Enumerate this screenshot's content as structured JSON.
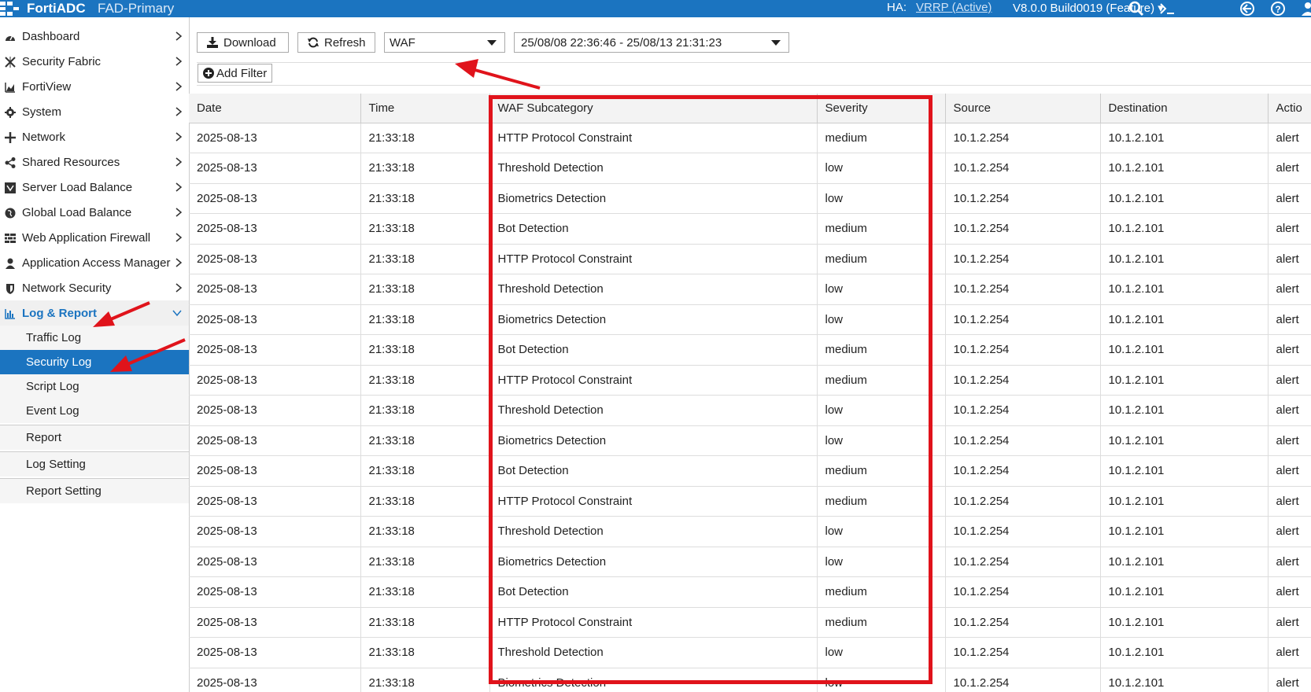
{
  "header": {
    "brand": "FortiADC",
    "hostname": "FAD-Primary",
    "ha_label": "HA:",
    "ha_value": "VRRP (Active)",
    "version": "V8.0.0 Build0019 (Feature)",
    "icons": [
      "search-icon",
      "cli-console-icon",
      "back-icon",
      "help-icon",
      "user-icon"
    ]
  },
  "sidebar": {
    "items": [
      {
        "label": "Dashboard",
        "icon": "dashboard-icon"
      },
      {
        "label": "Security Fabric",
        "icon": "fabric-icon"
      },
      {
        "label": "FortiView",
        "icon": "fortiview-icon"
      },
      {
        "label": "System",
        "icon": "gear-icon"
      },
      {
        "label": "Network",
        "icon": "network-icon"
      },
      {
        "label": "Shared Resources",
        "icon": "share-icon"
      },
      {
        "label": "Server Load Balance",
        "icon": "server-lb-icon"
      },
      {
        "label": "Global Load Balance",
        "icon": "globe-icon"
      },
      {
        "label": "Web Application Firewall",
        "icon": "waf-icon"
      },
      {
        "label": "Application Access Manager",
        "icon": "user-icon"
      },
      {
        "label": "Network Security",
        "icon": "shield-icon"
      },
      {
        "label": "Log & Report",
        "icon": "chart-icon"
      }
    ],
    "subitems": [
      {
        "label": "Traffic Log"
      },
      {
        "label": "Security Log"
      },
      {
        "label": "Script Log"
      },
      {
        "label": "Event Log"
      },
      {
        "label": "Report"
      },
      {
        "label": "Log Setting"
      },
      {
        "label": "Report Setting"
      }
    ],
    "active_item": "Log & Report",
    "selected_subitem": "Security Log"
  },
  "toolbar": {
    "download_label": "Download",
    "refresh_label": "Refresh",
    "log_type": "WAF",
    "time_range": "25/08/08 22:36:46 - 25/08/13 21:31:23",
    "add_filter_label": "Add Filter"
  },
  "table": {
    "columns": [
      "Date",
      "Time",
      "WAF Subcategory",
      "Severity",
      "Source",
      "Destination",
      "Actio"
    ],
    "rows": [
      [
        "2025-08-13",
        "21:33:18",
        "HTTP Protocol Constraint",
        "medium",
        "10.1.2.254",
        "10.1.2.101",
        "alert"
      ],
      [
        "2025-08-13",
        "21:33:18",
        "Threshold Detection",
        "low",
        "10.1.2.254",
        "10.1.2.101",
        "alert"
      ],
      [
        "2025-08-13",
        "21:33:18",
        "Biometrics Detection",
        "low",
        "10.1.2.254",
        "10.1.2.101",
        "alert"
      ],
      [
        "2025-08-13",
        "21:33:18",
        "Bot Detection",
        "medium",
        "10.1.2.254",
        "10.1.2.101",
        "alert"
      ],
      [
        "2025-08-13",
        "21:33:18",
        "HTTP Protocol Constraint",
        "medium",
        "10.1.2.254",
        "10.1.2.101",
        "alert"
      ],
      [
        "2025-08-13",
        "21:33:18",
        "Threshold Detection",
        "low",
        "10.1.2.254",
        "10.1.2.101",
        "alert"
      ],
      [
        "2025-08-13",
        "21:33:18",
        "Biometrics Detection",
        "low",
        "10.1.2.254",
        "10.1.2.101",
        "alert"
      ],
      [
        "2025-08-13",
        "21:33:18",
        "Bot Detection",
        "medium",
        "10.1.2.254",
        "10.1.2.101",
        "alert"
      ],
      [
        "2025-08-13",
        "21:33:18",
        "HTTP Protocol Constraint",
        "medium",
        "10.1.2.254",
        "10.1.2.101",
        "alert"
      ],
      [
        "2025-08-13",
        "21:33:18",
        "Threshold Detection",
        "low",
        "10.1.2.254",
        "10.1.2.101",
        "alert"
      ],
      [
        "2025-08-13",
        "21:33:18",
        "Biometrics Detection",
        "low",
        "10.1.2.254",
        "10.1.2.101",
        "alert"
      ],
      [
        "2025-08-13",
        "21:33:18",
        "Bot Detection",
        "medium",
        "10.1.2.254",
        "10.1.2.101",
        "alert"
      ],
      [
        "2025-08-13",
        "21:33:18",
        "HTTP Protocol Constraint",
        "medium",
        "10.1.2.254",
        "10.1.2.101",
        "alert"
      ],
      [
        "2025-08-13",
        "21:33:18",
        "Threshold Detection",
        "low",
        "10.1.2.254",
        "10.1.2.101",
        "alert"
      ],
      [
        "2025-08-13",
        "21:33:18",
        "Biometrics Detection",
        "low",
        "10.1.2.254",
        "10.1.2.101",
        "alert"
      ],
      [
        "2025-08-13",
        "21:33:18",
        "Bot Detection",
        "medium",
        "10.1.2.254",
        "10.1.2.101",
        "alert"
      ],
      [
        "2025-08-13",
        "21:33:18",
        "HTTP Protocol Constraint",
        "medium",
        "10.1.2.254",
        "10.1.2.101",
        "alert"
      ],
      [
        "2025-08-13",
        "21:33:18",
        "Threshold Detection",
        "low",
        "10.1.2.254",
        "10.1.2.101",
        "alert"
      ],
      [
        "2025-08-13",
        "21:33:18",
        "Biometrics Detection",
        "low",
        "10.1.2.254",
        "10.1.2.101",
        "alert"
      ]
    ]
  },
  "colors": {
    "brand_blue": "#1b74c0",
    "annotation_red": "#e0131b"
  }
}
